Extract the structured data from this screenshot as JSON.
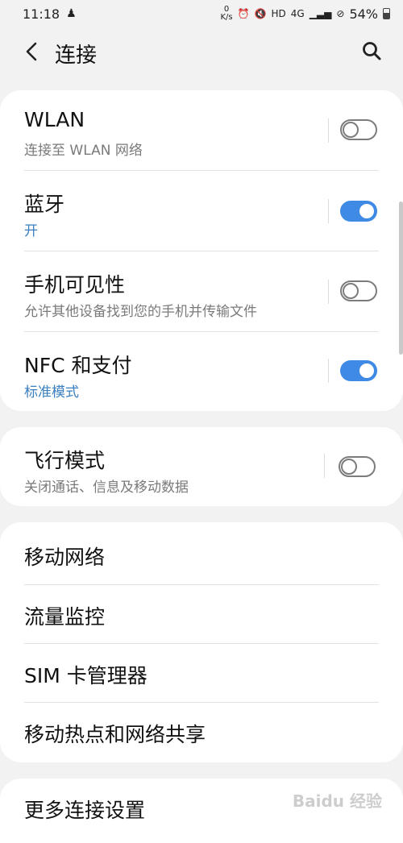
{
  "status_bar": {
    "time": "11:18",
    "net_speed_top": "0",
    "net_speed_unit": "K/s",
    "hd": "HD",
    "signal": "4G",
    "battery": "54%"
  },
  "header": {
    "title": "连接"
  },
  "section1": {
    "wlan": {
      "label": "WLAN",
      "sub": "连接至 WLAN 网络",
      "on": false
    },
    "bluetooth": {
      "label": "蓝牙",
      "sub": "开",
      "on": true
    },
    "visibility": {
      "label": "手机可见性",
      "sub": "允许其他设备找到您的手机并传输文件",
      "on": false
    },
    "nfc": {
      "label": "NFC 和支付",
      "sub": "标准模式",
      "on": true
    }
  },
  "section2": {
    "airplane": {
      "label": "飞行模式",
      "sub": "关闭通话、信息及移动数据",
      "on": false
    }
  },
  "section3": {
    "items": [
      "移动网络",
      "流量监控",
      "SIM 卡管理器",
      "移动热点和网络共享"
    ]
  },
  "section4": {
    "more": "更多连接设置"
  },
  "colors": {
    "accent": "#3f8ae4",
    "sub_link": "#3a7fc0",
    "background": "#f2f2f2"
  },
  "watermark": "Baidu 经验"
}
